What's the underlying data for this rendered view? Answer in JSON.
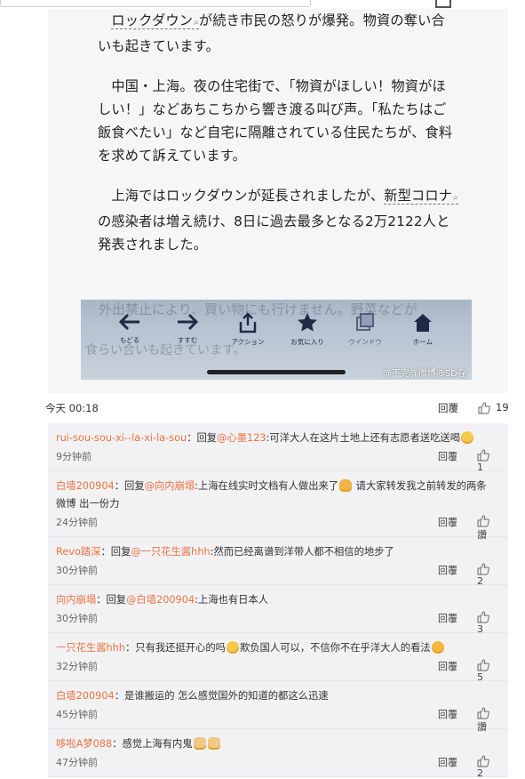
{
  "article": {
    "p1_link": "ロックダウン",
    "p1_rest": "が続き市民の怒りが爆発。物資の奪い合いも起きています。",
    "p2": "中国・上海。夜の住宅街で、「物資がほしい！物資がほしい！」などあちこちから響き渡る叫び声。「私たちはご飯食べたい」など自宅に隔離されている住民たちが、食料を求めて訴えています。",
    "p3_a": "上海ではロックダウンが延長されましたが、",
    "p3_link": "新型コロナ",
    "p3_b": "の感染者は増え続け、8日に過去最多となる2万2122人と発表されました。",
    "p4_ghost": "外出禁止により、買い物にも行けません。野菜などが",
    "p5_ghost": "食らい合いも起きています。"
  },
  "navbar": {
    "items": [
      {
        "label": "もどる",
        "icon": "back-arrow-icon"
      },
      {
        "label": "すすむ",
        "icon": "forward-arrow-icon"
      },
      {
        "label": "アクション",
        "icon": "share-icon"
      },
      {
        "label": "お気に入り",
        "icon": "star-icon"
      },
      {
        "label": "ウインドウ",
        "icon": "window-icon"
      },
      {
        "label": "ホーム",
        "icon": "home-icon"
      }
    ],
    "watermark": "@不完@微博@SD存"
  },
  "post_meta": {
    "time": "今天 00:18",
    "reply_label": "回覆",
    "like_count": "19"
  },
  "comments": [
    {
      "name": "rui-sou-sou-xi--la-xi-la-sou",
      "prefix": "：回复",
      "at": "@心墨123",
      "text": ":可洋大人在这片土地上还有志愿者送吃送喝",
      "emoji": "smile",
      "time": "9分钟前",
      "reply": "回覆",
      "likes": "1"
    },
    {
      "name": "白墙200904",
      "prefix": "：回复",
      "at": "@向内崩塌",
      "text": ":上海在线实时文档有人做出来了",
      "emoji": "pray",
      "text2": " 请大家转发我之前转发的两条微博 出一份力",
      "time": "24分钟前",
      "reply": "回覆",
      "likes": "讚"
    },
    {
      "name": "Revo踏深",
      "prefix": "：回复",
      "at": "@一只花生酱hhh",
      "text": ":然而已经离谱到洋带人都不相信的地步了",
      "time": "30分钟前",
      "reply": "回覆",
      "likes": "2"
    },
    {
      "name": "向内崩塌",
      "prefix": "：回复",
      "at": "@白墙200904",
      "text": ":上海也有日本人",
      "time": "30分钟前",
      "reply": "回覆",
      "likes": "3"
    },
    {
      "name": "一只花生酱hhh",
      "prefix": "：只有我还挺开心的吗",
      "emoji": "blush",
      "text": "欺负国人可以，不信你不在乎洋大人的看法",
      "emoji2": "kiss",
      "time": "32分钟前",
      "reply": "回覆",
      "likes": "5"
    },
    {
      "name": "白墙200904",
      "prefix": "：是谁搬运的 怎么感觉国外的知道的都这么迅速",
      "time": "45分钟前",
      "reply": "回覆",
      "likes": "讚"
    },
    {
      "name": "哆啦A梦088",
      "prefix": "：感觉上海有内鬼",
      "emoji": "cat",
      "time": "47分钟前",
      "reply": "回覆",
      "likes": "2"
    }
  ]
}
